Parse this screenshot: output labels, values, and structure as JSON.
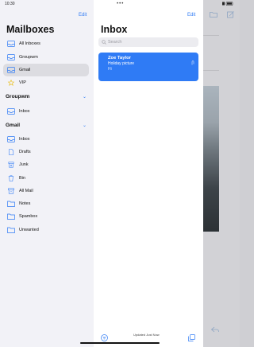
{
  "status": {
    "time": "10:30"
  },
  "sidebar": {
    "edit_label": "Edit",
    "title": "Mailboxes",
    "items": [
      {
        "label": "All Inboxes",
        "icon": "tray-stack-icon"
      },
      {
        "label": "Groupwm",
        "icon": "tray-icon"
      },
      {
        "label": "Gmail",
        "icon": "tray-icon",
        "selected": true
      },
      {
        "label": "VIP",
        "icon": "star-icon"
      }
    ],
    "sections": [
      {
        "title": "Groupwm",
        "items": [
          {
            "label": "Inbox",
            "icon": "tray-icon"
          }
        ]
      },
      {
        "title": "Gmail",
        "items": [
          {
            "label": "Inbox",
            "icon": "tray-icon"
          },
          {
            "label": "Drafts",
            "icon": "document-icon"
          },
          {
            "label": "Junk",
            "icon": "junk-bin-icon"
          },
          {
            "label": "Bin",
            "icon": "trash-icon"
          },
          {
            "label": "All Mail",
            "icon": "archive-icon"
          },
          {
            "label": "Notes",
            "icon": "folder-icon"
          },
          {
            "label": "Spambox",
            "icon": "folder-icon"
          },
          {
            "label": "Unwanted",
            "icon": "folder-icon"
          }
        ]
      }
    ]
  },
  "list": {
    "edit_label": "Edit",
    "title": "Inbox",
    "search_placeholder": "Search",
    "messages": [
      {
        "from": "Zoe Taylor",
        "subject": "Holiday picture",
        "preview": "Hi"
      }
    ],
    "status_text": "Updated Just Now"
  },
  "colors": {
    "accent": "#2f7bf5",
    "sidebar_bg": "#f2f2f7",
    "selected_bg": "#dcdce1"
  }
}
